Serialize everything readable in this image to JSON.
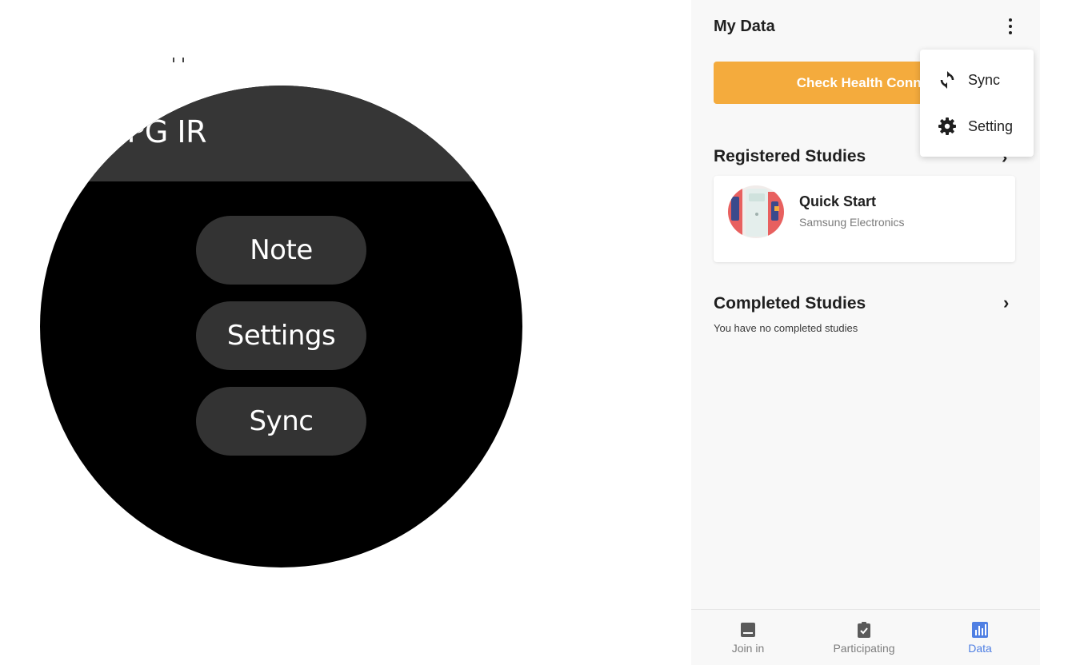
{
  "watch": {
    "title": "PPG IR",
    "buttons": [
      {
        "label": "Note"
      },
      {
        "label": "Settings"
      },
      {
        "label": "Sync"
      }
    ]
  },
  "phone": {
    "title": "My Data",
    "check_button": "Check Health Connect",
    "menu": [
      {
        "label": "Sync",
        "icon": "sync-icon"
      },
      {
        "label": "Setting",
        "icon": "gear-icon"
      }
    ],
    "registered": {
      "title": "Registered Studies",
      "studies": [
        {
          "name": "Quick Start",
          "org": "Samsung Electronics"
        }
      ]
    },
    "completed": {
      "title": "Completed Studies",
      "empty": "You have no completed studies"
    },
    "nav": [
      {
        "label": "Join in",
        "icon": "book-icon",
        "active": false
      },
      {
        "label": "Participating",
        "icon": "clipboard-check-icon",
        "active": false
      },
      {
        "label": "Data",
        "icon": "bar-chart-icon",
        "active": true
      }
    ]
  },
  "colors": {
    "accent_orange": "#f4ab3d",
    "active_blue": "#4f7fe3",
    "watch_button": "#333333"
  }
}
